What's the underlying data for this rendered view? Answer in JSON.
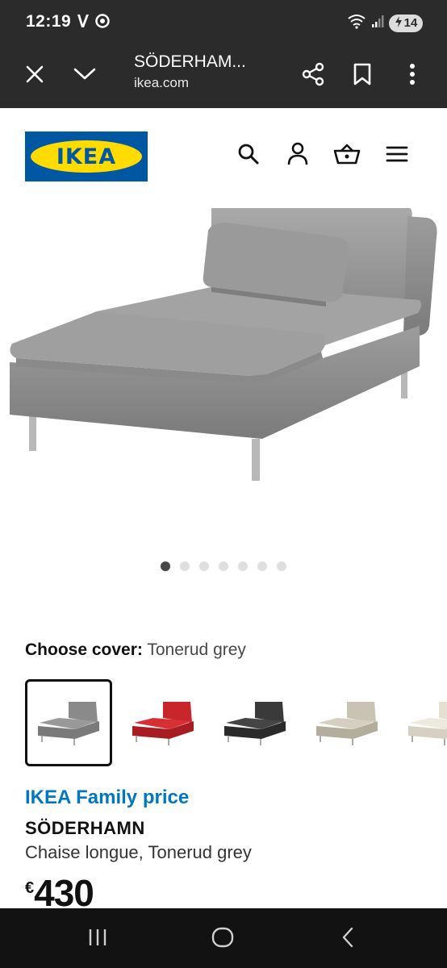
{
  "status_bar": {
    "time": "12:19",
    "battery": "14"
  },
  "browser": {
    "page_title": "SÖDERHAM...",
    "domain": "ikea.com",
    "icons": [
      "close-icon",
      "chevron-down-icon",
      "share-icon",
      "bookmark-icon",
      "more-vert-icon"
    ]
  },
  "site": {
    "logo_text": "IKEA",
    "header_icons": [
      "search-icon",
      "user-icon",
      "basket-icon",
      "menu-icon"
    ]
  },
  "gallery": {
    "dot_count": 7,
    "active_dot": 0
  },
  "cover": {
    "label": "Choose cover:",
    "value": "Tonerud grey",
    "swatches": [
      {
        "name": "Tonerud grey",
        "color": "#8a8a8a",
        "selected": true
      },
      {
        "name": "red",
        "color": "#c8262b",
        "selected": false
      },
      {
        "name": "dark grey",
        "color": "#3a3a3a",
        "selected": false
      },
      {
        "name": "beige",
        "color": "#c9c3b4",
        "selected": false
      },
      {
        "name": "light beige",
        "color": "#e6e0d3",
        "selected": false
      }
    ]
  },
  "product": {
    "family_price_label": "IKEA Family price",
    "name": "SÖDERHAMN",
    "description": "Chaise longue, Tonerud grey",
    "currency": "€",
    "price": "430"
  },
  "colors": {
    "ikea_blue": "#0058a3",
    "ikea_yellow": "#ffdb00",
    "family_blue": "#0077c1"
  }
}
